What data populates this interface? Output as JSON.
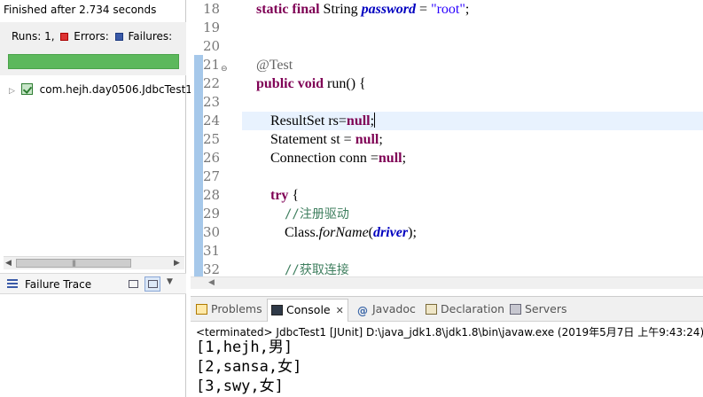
{
  "junit": {
    "finished_text": "Finished after 2.734 seconds",
    "runs_label": "Runs:",
    "runs_value": "1,",
    "errors_label": "Errors:",
    "failures_label": "Failures:",
    "progress_fraction": 1.0,
    "progress_color": "#5cb85c",
    "tree_item": "com.hejh.day0506.JdbcTest1",
    "failure_trace_label": "Failure Trace"
  },
  "editor": {
    "line_numbers": [
      "18",
      "19",
      "20",
      "21",
      "22",
      "23",
      "24",
      "25",
      "26",
      "27",
      "28",
      "29",
      "30",
      "31",
      "32"
    ],
    "lines": {
      "l18": {
        "kw1": "static final",
        "type": " String ",
        "field": "password",
        "eq": " = ",
        "str": "\"root\"",
        "end": ";"
      },
      "l21": {
        "ann": "@Test"
      },
      "l22": {
        "kw": "public void",
        "rest": " run() {"
      },
      "l24": {
        "type": "ResultSet rs=",
        "kw": "null",
        "end": ";"
      },
      "l25": {
        "type": "Statement st = ",
        "kw": "null",
        "end": ";"
      },
      "l26": {
        "type": "Connection conn =",
        "kw": "null",
        "end": ";"
      },
      "l28": {
        "kw": "try",
        "rest": " {"
      },
      "l29": {
        "cmt": "//注册驱动"
      },
      "l30": {
        "pre": "Class.",
        "it": "forName",
        "paren": "(",
        "field": "driver",
        "end": ");"
      },
      "l32": {
        "cmt": "//获取连接"
      }
    }
  },
  "views": {
    "tabs": {
      "problems": "Problems",
      "console": "Console",
      "javadoc": "Javadoc",
      "declaration": "Declaration",
      "servers": "Servers"
    },
    "close_glyph": "✕",
    "status_line": "<terminated> JdbcTest1 [JUnit] D:\\java_jdk1.8\\jdk1.8\\bin\\javaw.exe (2019年5月7日 上午9:43:24)",
    "console_lines": [
      "[1,hejh,男]",
      "[2,sansa,女]",
      "[3,swy,女]"
    ]
  }
}
